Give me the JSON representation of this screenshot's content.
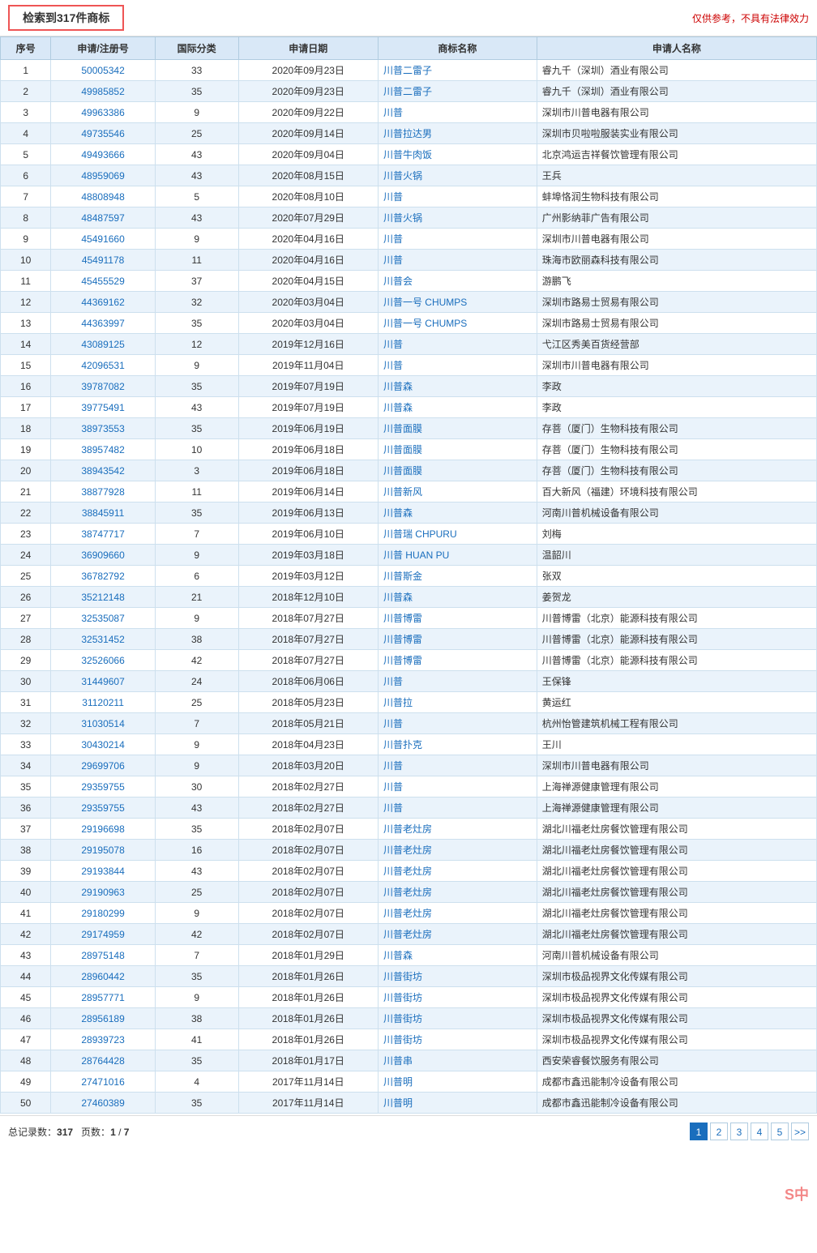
{
  "topBar": {
    "searchResult": "检索到317件商标",
    "disclaimer": "仅供参考，不具有法律效力"
  },
  "table": {
    "headers": [
      "序号",
      "申请/注册号",
      "国际分类",
      "申请日期",
      "商标名称",
      "申请人名称"
    ],
    "rows": [
      [
        "1",
        "50005342",
        "33",
        "2020年09月23日",
        "川普二雷子",
        "睿九千（深圳）酒业有限公司"
      ],
      [
        "2",
        "49985852",
        "35",
        "2020年09月23日",
        "川普二雷子",
        "睿九千（深圳）酒业有限公司"
      ],
      [
        "3",
        "49963386",
        "9",
        "2020年09月22日",
        "川普",
        "深圳市川普电器有限公司"
      ],
      [
        "4",
        "49735546",
        "25",
        "2020年09月14日",
        "川普拉达男",
        "深圳市贝啦啦服装实业有限公司"
      ],
      [
        "5",
        "49493666",
        "43",
        "2020年09月04日",
        "川普牛肉饭",
        "北京鸿运吉祥餐饮管理有限公司"
      ],
      [
        "6",
        "48959069",
        "43",
        "2020年08月15日",
        "川普火锅",
        "王兵"
      ],
      [
        "7",
        "48808948",
        "5",
        "2020年08月10日",
        "川普",
        "蚌埠恪润生物科技有限公司"
      ],
      [
        "8",
        "48487597",
        "43",
        "2020年07月29日",
        "川普火锅",
        "广州影纳菲广告有限公司"
      ],
      [
        "9",
        "45491660",
        "9",
        "2020年04月16日",
        "川普",
        "深圳市川普电器有限公司"
      ],
      [
        "10",
        "45491178",
        "11",
        "2020年04月16日",
        "川普",
        "珠海市欧丽森科技有限公司"
      ],
      [
        "11",
        "45455529",
        "37",
        "2020年04月15日",
        "川普会",
        "游鹏飞"
      ],
      [
        "12",
        "44369162",
        "32",
        "2020年03月04日",
        "川普一号 CHUMPS",
        "深圳市路易士贸易有限公司"
      ],
      [
        "13",
        "44363997",
        "35",
        "2020年03月04日",
        "川普一号 CHUMPS",
        "深圳市路易士贸易有限公司"
      ],
      [
        "14",
        "43089125",
        "12",
        "2019年12月16日",
        "川普",
        "弋江区秀美百货经营部"
      ],
      [
        "15",
        "42096531",
        "9",
        "2019年11月04日",
        "川普",
        "深圳市川普电器有限公司"
      ],
      [
        "16",
        "39787082",
        "35",
        "2019年07月19日",
        "川普森",
        "李政"
      ],
      [
        "17",
        "39775491",
        "43",
        "2019年07月19日",
        "川普森",
        "李政"
      ],
      [
        "18",
        "38973553",
        "35",
        "2019年06月19日",
        "川普面膜",
        "存菩（厦门）生物科技有限公司"
      ],
      [
        "19",
        "38957482",
        "10",
        "2019年06月18日",
        "川普面膜",
        "存菩（厦门）生物科技有限公司"
      ],
      [
        "20",
        "38943542",
        "3",
        "2019年06月18日",
        "川普面膜",
        "存菩（厦门）生物科技有限公司"
      ],
      [
        "21",
        "38877928",
        "11",
        "2019年06月14日",
        "川普新风",
        "百大新风（福建）环境科技有限公司"
      ],
      [
        "22",
        "38845911",
        "35",
        "2019年06月13日",
        "川普森",
        "河南川普机械设备有限公司"
      ],
      [
        "23",
        "38747717",
        "7",
        "2019年06月10日",
        "川普瑞 CHPURU",
        "刘梅"
      ],
      [
        "24",
        "36909660",
        "9",
        "2019年03月18日",
        "川普 HUAN PU",
        "温韶川"
      ],
      [
        "25",
        "36782792",
        "6",
        "2019年03月12日",
        "川普斯金",
        "张双"
      ],
      [
        "26",
        "35212148",
        "21",
        "2018年12月10日",
        "川普森",
        "姜贺龙"
      ],
      [
        "27",
        "32535087",
        "9",
        "2018年07月27日",
        "川普博雷",
        "川普博雷（北京）能源科技有限公司"
      ],
      [
        "28",
        "32531452",
        "38",
        "2018年07月27日",
        "川普博雷",
        "川普博雷（北京）能源科技有限公司"
      ],
      [
        "29",
        "32526066",
        "42",
        "2018年07月27日",
        "川普博雷",
        "川普博雷（北京）能源科技有限公司"
      ],
      [
        "30",
        "31449607",
        "24",
        "2018年06月06日",
        "川普",
        "王保锋"
      ],
      [
        "31",
        "31120211",
        "25",
        "2018年05月23日",
        "川普拉",
        "黄运红"
      ],
      [
        "32",
        "31030514",
        "7",
        "2018年05月21日",
        "川普",
        "杭州怡管建筑机械工程有限公司"
      ],
      [
        "33",
        "30430214",
        "9",
        "2018年04月23日",
        "川普扑克",
        "王川"
      ],
      [
        "34",
        "29699706",
        "9",
        "2018年03月20日",
        "川普",
        "深圳市川普电器有限公司"
      ],
      [
        "35",
        "29359755",
        "30",
        "2018年02月27日",
        "川普",
        "上海禅源健康管理有限公司"
      ],
      [
        "36",
        "29359755",
        "43",
        "2018年02月27日",
        "川普",
        "上海禅源健康管理有限公司"
      ],
      [
        "37",
        "29196698",
        "35",
        "2018年02月07日",
        "川普老灶房",
        "湖北川福老灶房餐饮管理有限公司"
      ],
      [
        "38",
        "29195078",
        "16",
        "2018年02月07日",
        "川普老灶房",
        "湖北川福老灶房餐饮管理有限公司"
      ],
      [
        "39",
        "29193844",
        "43",
        "2018年02月07日",
        "川普老灶房",
        "湖北川福老灶房餐饮管理有限公司"
      ],
      [
        "40",
        "29190963",
        "25",
        "2018年02月07日",
        "川普老灶房",
        "湖北川福老灶房餐饮管理有限公司"
      ],
      [
        "41",
        "29180299",
        "9",
        "2018年02月07日",
        "川普老灶房",
        "湖北川福老灶房餐饮管理有限公司"
      ],
      [
        "42",
        "29174959",
        "42",
        "2018年02月07日",
        "川普老灶房",
        "湖北川福老灶房餐饮管理有限公司"
      ],
      [
        "43",
        "28975148",
        "7",
        "2018年01月29日",
        "川普森",
        "河南川普机械设备有限公司"
      ],
      [
        "44",
        "28960442",
        "35",
        "2018年01月26日",
        "川普街坊",
        "深圳市极品视界文化传媒有限公司"
      ],
      [
        "45",
        "28957771",
        "9",
        "2018年01月26日",
        "川普街坊",
        "深圳市极品视界文化传媒有限公司"
      ],
      [
        "46",
        "28956189",
        "38",
        "2018年01月26日",
        "川普街坊",
        "深圳市极品视界文化传媒有限公司"
      ],
      [
        "47",
        "28939723",
        "41",
        "2018年01月26日",
        "川普街坊",
        "深圳市极品视界文化传媒有限公司"
      ],
      [
        "48",
        "28764428",
        "35",
        "2018年01月17日",
        "川普串",
        "西安荣睿餐饮服务有限公司"
      ],
      [
        "49",
        "27471016",
        "4",
        "2017年11月14日",
        "川普明",
        "成都市鑫迅能制冷设备有限公司"
      ],
      [
        "50",
        "27460389",
        "35",
        "2017年11月14日",
        "川普明",
        "成都市鑫迅能制冷设备有限公司"
      ]
    ]
  },
  "footer": {
    "totalLabel": "总记录数",
    "totalValue": "317",
    "pageLabel": "页数",
    "currentPage": "1",
    "totalPages": "7",
    "pages": [
      "1",
      "2",
      "3",
      "4",
      "5"
    ],
    "prevLabel": "<",
    "nextLabel": ">>"
  },
  "watermark": "S中"
}
